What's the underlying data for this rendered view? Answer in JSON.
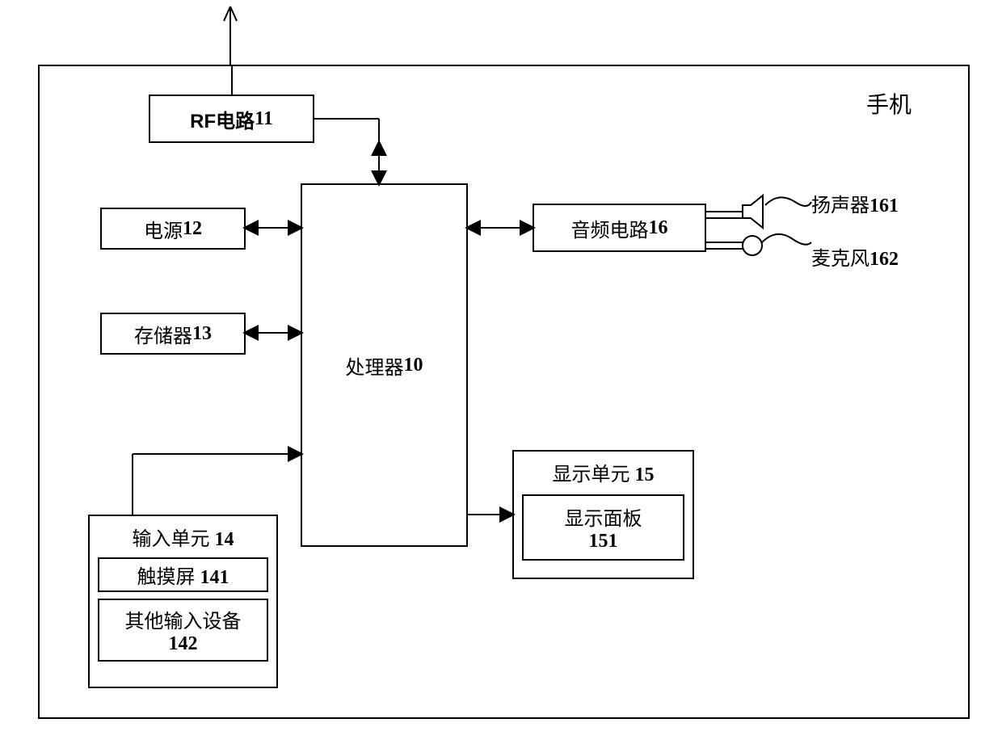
{
  "blocks": {
    "phone": "手机",
    "rf": {
      "name": "RF电路",
      "num": "11"
    },
    "power": {
      "name": "电源",
      "num": "12"
    },
    "memory": {
      "name": "存储器",
      "num": "13"
    },
    "processor": {
      "name": "处理器",
      "num": "10"
    },
    "audio": {
      "name": "音频电路",
      "num": "16"
    },
    "speaker": {
      "name": "扬声器",
      "num": "161"
    },
    "mic": {
      "name": "麦克风",
      "num": "162"
    },
    "display_unit": {
      "name": "显示单元",
      "num": "15"
    },
    "display_panel": {
      "name": "显示面板",
      "num": "151"
    },
    "input_unit": {
      "name": "输入单元",
      "num": "14"
    },
    "touch": {
      "name": "触摸屏",
      "num": "141"
    },
    "other_input": {
      "name": "其他输入设备",
      "num": "142"
    }
  }
}
